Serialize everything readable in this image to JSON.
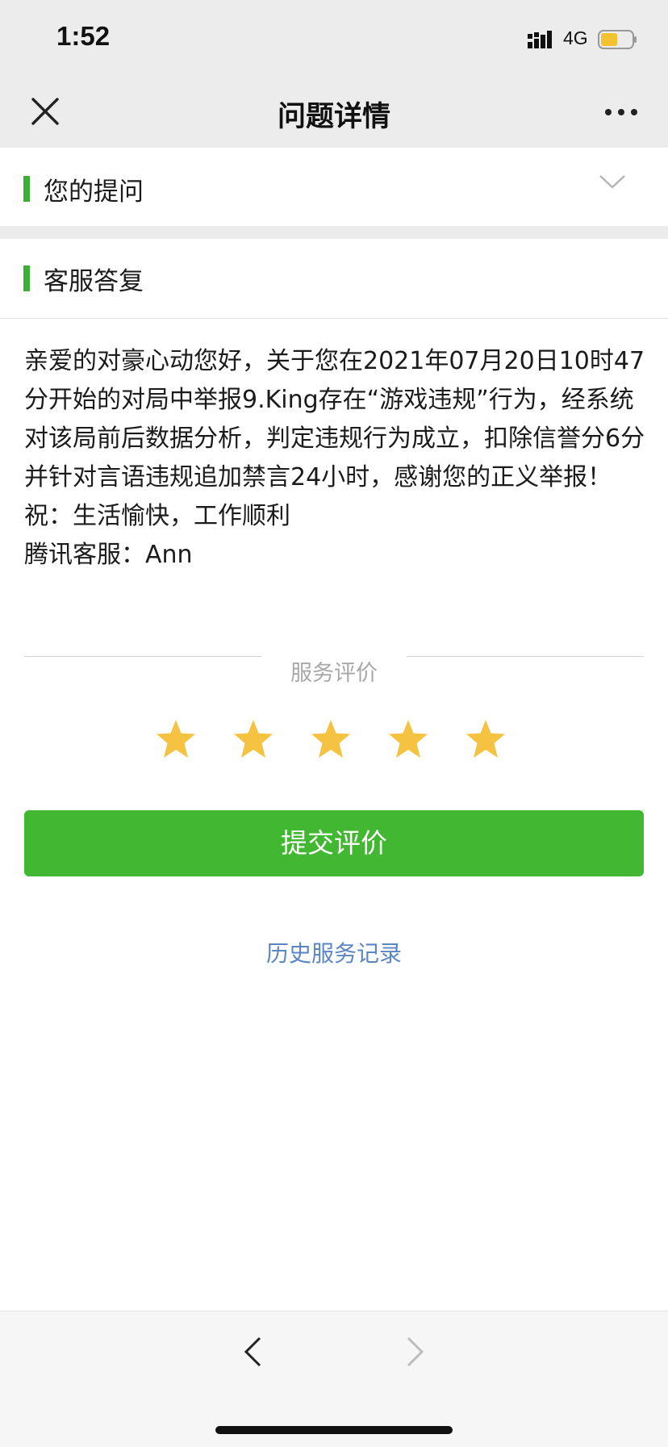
{
  "status_bar": {
    "time": "1:52",
    "network": "4G",
    "battery_color": "#f2c230"
  },
  "nav_bar": {
    "title": "问题详情",
    "close_icon": "close-icon",
    "more_icon": "more-icon"
  },
  "question_section": {
    "label": "您的提问",
    "accent_color": "#3cb034"
  },
  "reply_section": {
    "label": "客服答复",
    "body": "亲爱的对豪心动您好，关于您在2021年07月20日10时47分开始的对局中举报9.King存在“游戏违规”行为，经系统对该局前后数据分析，判定违规行为成立，扣除信誉分6分并针对言语违规追加禁言24小时，感谢您的正义举报！\n祝：生活愉快，工作顺利\n腾讯客服：Ann"
  },
  "rating": {
    "label": "服务评价",
    "stars": 5,
    "star_color": "#f5c242"
  },
  "submit": {
    "label": "提交评价",
    "color": "#42b832"
  },
  "history": {
    "label": "历史服务记录",
    "color": "#5b86c4"
  }
}
